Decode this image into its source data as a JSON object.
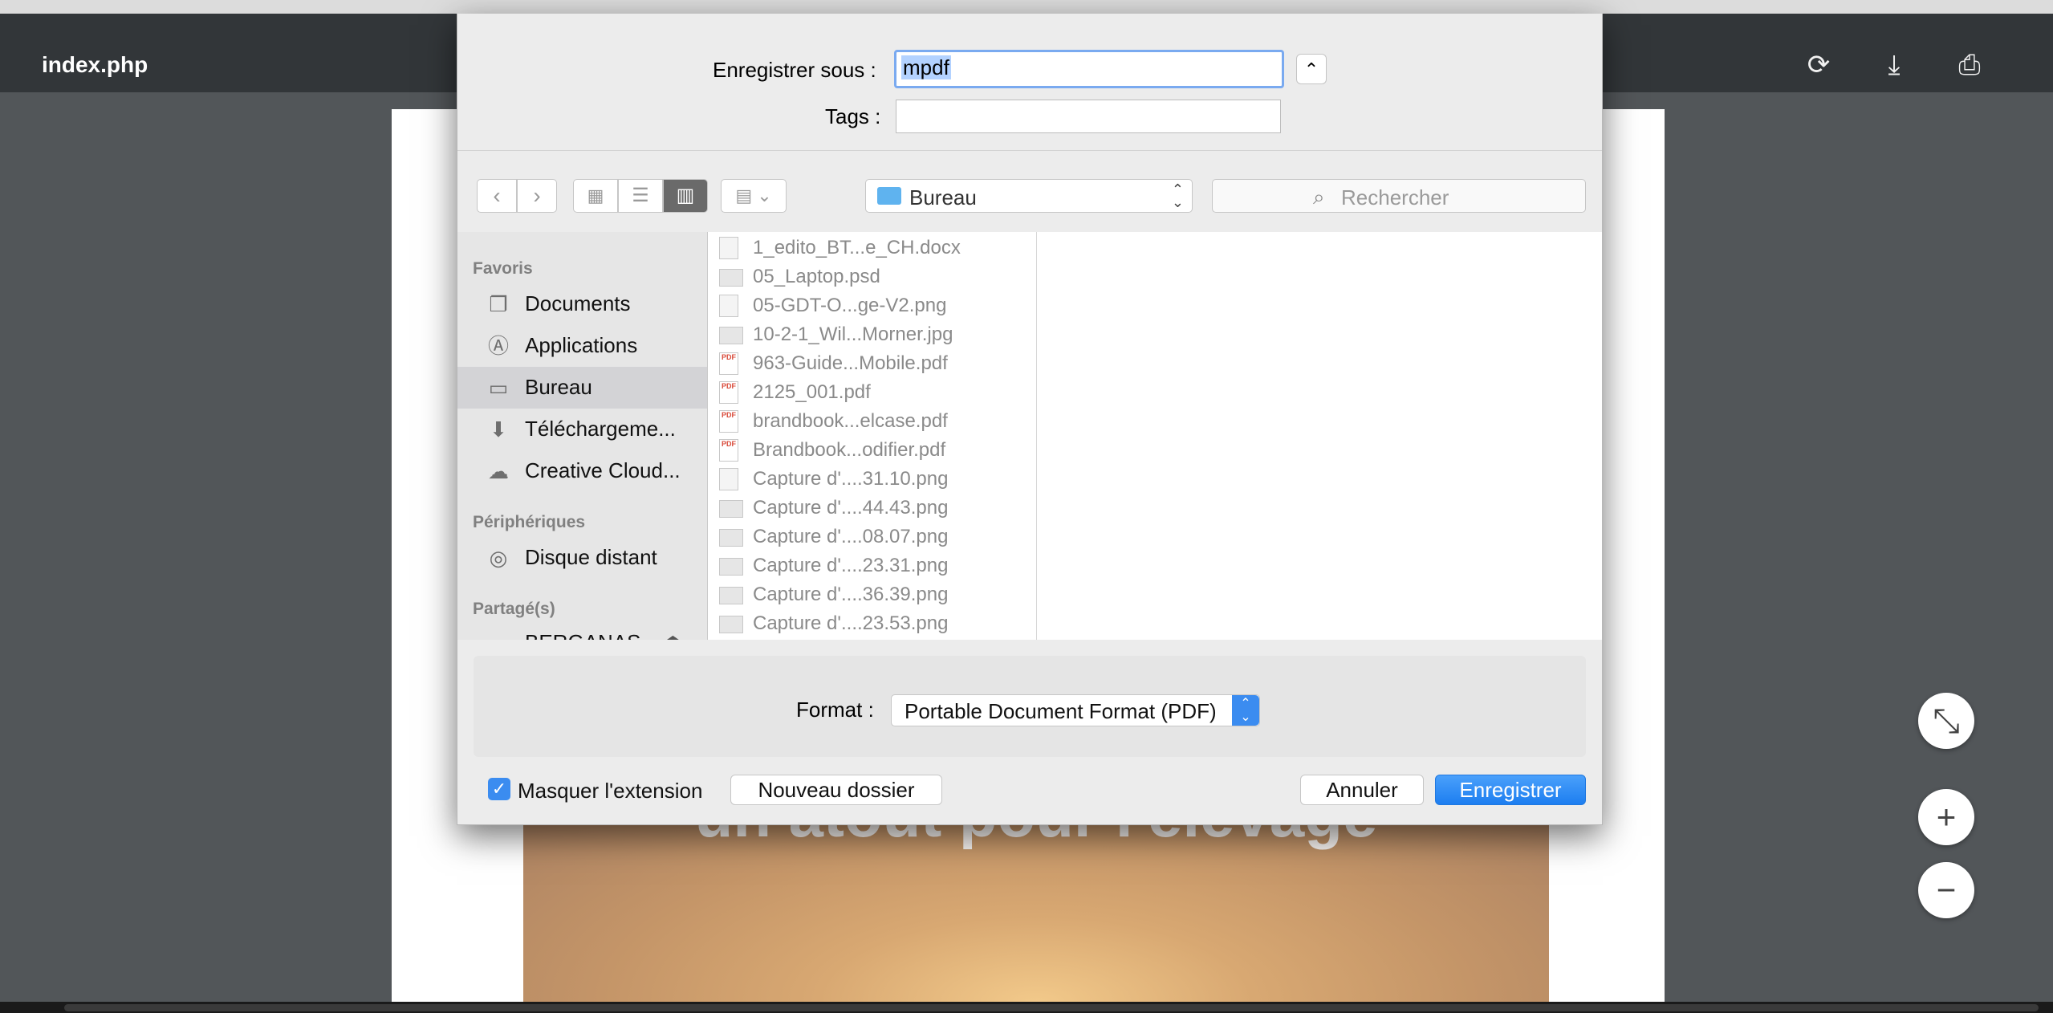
{
  "viewer": {
    "title": "index.php",
    "page_heading": "un atout pour l'élevage",
    "toolbar_icons": [
      "rotate-icon",
      "download-icon",
      "print-icon"
    ],
    "zoom_icons": [
      "fit-page-icon",
      "zoom-in-icon",
      "zoom-out-icon"
    ]
  },
  "dialog": {
    "save_as_label": "Enregistrer sous :",
    "filename": "mpdf",
    "tags_label": "Tags :",
    "tags_value": "",
    "location": "Bureau",
    "search_placeholder": "Rechercher",
    "sidebar": {
      "favorites_header": "Favoris",
      "favorites": [
        {
          "label": "Documents",
          "icon": "documents-icon"
        },
        {
          "label": "Applications",
          "icon": "applications-icon"
        },
        {
          "label": "Bureau",
          "icon": "desktop-icon",
          "selected": true
        },
        {
          "label": "Téléchargeme...",
          "icon": "downloads-icon"
        },
        {
          "label": "Creative Cloud...",
          "icon": "creative-cloud-icon"
        }
      ],
      "devices_header": "Périphériques",
      "devices": [
        {
          "label": "Disque distant",
          "icon": "disc-icon"
        }
      ],
      "shared_header": "Partagé(s)",
      "shared": [
        {
          "label": "BERGANAS...",
          "icon": "server-icon"
        }
      ]
    },
    "files": [
      {
        "name": "1_edito_BT...e_CH.docx",
        "type": "doc"
      },
      {
        "name": "05_Laptop.psd",
        "type": "psd"
      },
      {
        "name": "05-GDT-O...ge-V2.png",
        "type": "png"
      },
      {
        "name": "10-2-1_Wil...Morner.jpg",
        "type": "jpg"
      },
      {
        "name": "963-Guide...Mobile.pdf",
        "type": "pdf"
      },
      {
        "name": "2125_001.pdf",
        "type": "pdf"
      },
      {
        "name": "brandbook...elcase.pdf",
        "type": "pdf"
      },
      {
        "name": "Brandbook...odifier.pdf",
        "type": "pdf"
      },
      {
        "name": "Capture d'....31.10.png",
        "type": "png"
      },
      {
        "name": "Capture d'....44.43.png",
        "type": "png"
      },
      {
        "name": "Capture d'....08.07.png",
        "type": "png"
      },
      {
        "name": "Capture d'....23.31.png",
        "type": "png"
      },
      {
        "name": "Capture d'....36.39.png",
        "type": "png"
      },
      {
        "name": "Capture d'....23.53.png",
        "type": "png"
      }
    ],
    "format_label": "Format :",
    "format_value": "Portable Document Format (PDF)",
    "hide_extension_label": "Masquer l'extension",
    "hide_extension_checked": true,
    "new_folder_button": "Nouveau dossier",
    "cancel_button": "Annuler",
    "save_button": "Enregistrer"
  }
}
